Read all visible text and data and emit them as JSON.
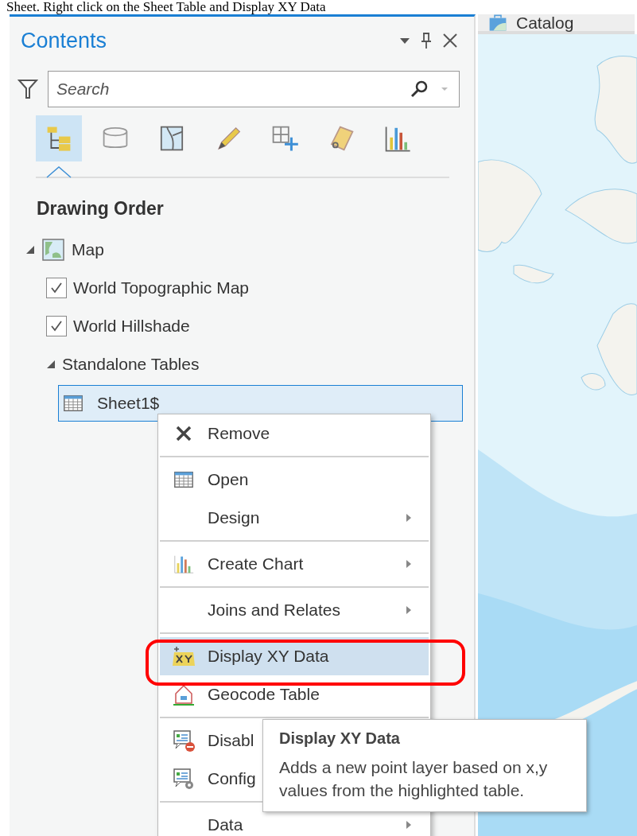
{
  "caption": "Sheet.  Right click on the Sheet Table and Display XY Data",
  "pane": {
    "title": "Contents",
    "search": {
      "placeholder": "Search"
    },
    "toolbar": [
      {
        "selected": true
      },
      {
        "selected": false
      },
      {
        "selected": false
      },
      {
        "selected": false
      },
      {
        "selected": false
      },
      {
        "selected": false
      },
      {
        "selected": false
      }
    ],
    "heading": "Drawing Order",
    "tree": [
      {
        "kind": "map",
        "label": "Map",
        "expanded": true,
        "selected": false,
        "children": [
          {
            "kind": "layer",
            "label": "World Topographic Map",
            "checked": true,
            "selected": false
          },
          {
            "kind": "layer",
            "label": "World Hillshade",
            "checked": true,
            "selected": false
          },
          {
            "kind": "group",
            "label": "Standalone Tables",
            "expanded": true,
            "selected": false,
            "children": [
              {
                "kind": "table",
                "label": "Sheet1$",
                "selected": true
              }
            ]
          }
        ]
      }
    ]
  },
  "tabs": [
    {
      "label": "Catalog",
      "selected": false
    }
  ],
  "menu": {
    "groups": [
      [
        {
          "label": "Remove",
          "submenu": false,
          "selected": false
        }
      ],
      [
        {
          "label": "Open",
          "submenu": false,
          "selected": false
        },
        {
          "label": "Design",
          "submenu": true,
          "selected": false
        }
      ],
      [
        {
          "label": "Create Chart",
          "submenu": true,
          "selected": false
        }
      ],
      [
        {
          "label": "Joins and Relates",
          "submenu": true,
          "selected": false
        }
      ],
      [
        {
          "label": "Display XY Data",
          "submenu": false,
          "selected": true
        },
        {
          "label": "Geocode Table",
          "submenu": false,
          "selected": false
        }
      ],
      [
        {
          "label": "Disabl",
          "submenu": false,
          "selected": false
        },
        {
          "label": "Config",
          "submenu": false,
          "selected": false
        }
      ],
      [
        {
          "label": "Data",
          "submenu": true,
          "selected": false
        }
      ]
    ]
  },
  "tooltip": {
    "title": "Display XY Data",
    "text": "Adds a new point layer based on x,y values from the highlighted table."
  }
}
